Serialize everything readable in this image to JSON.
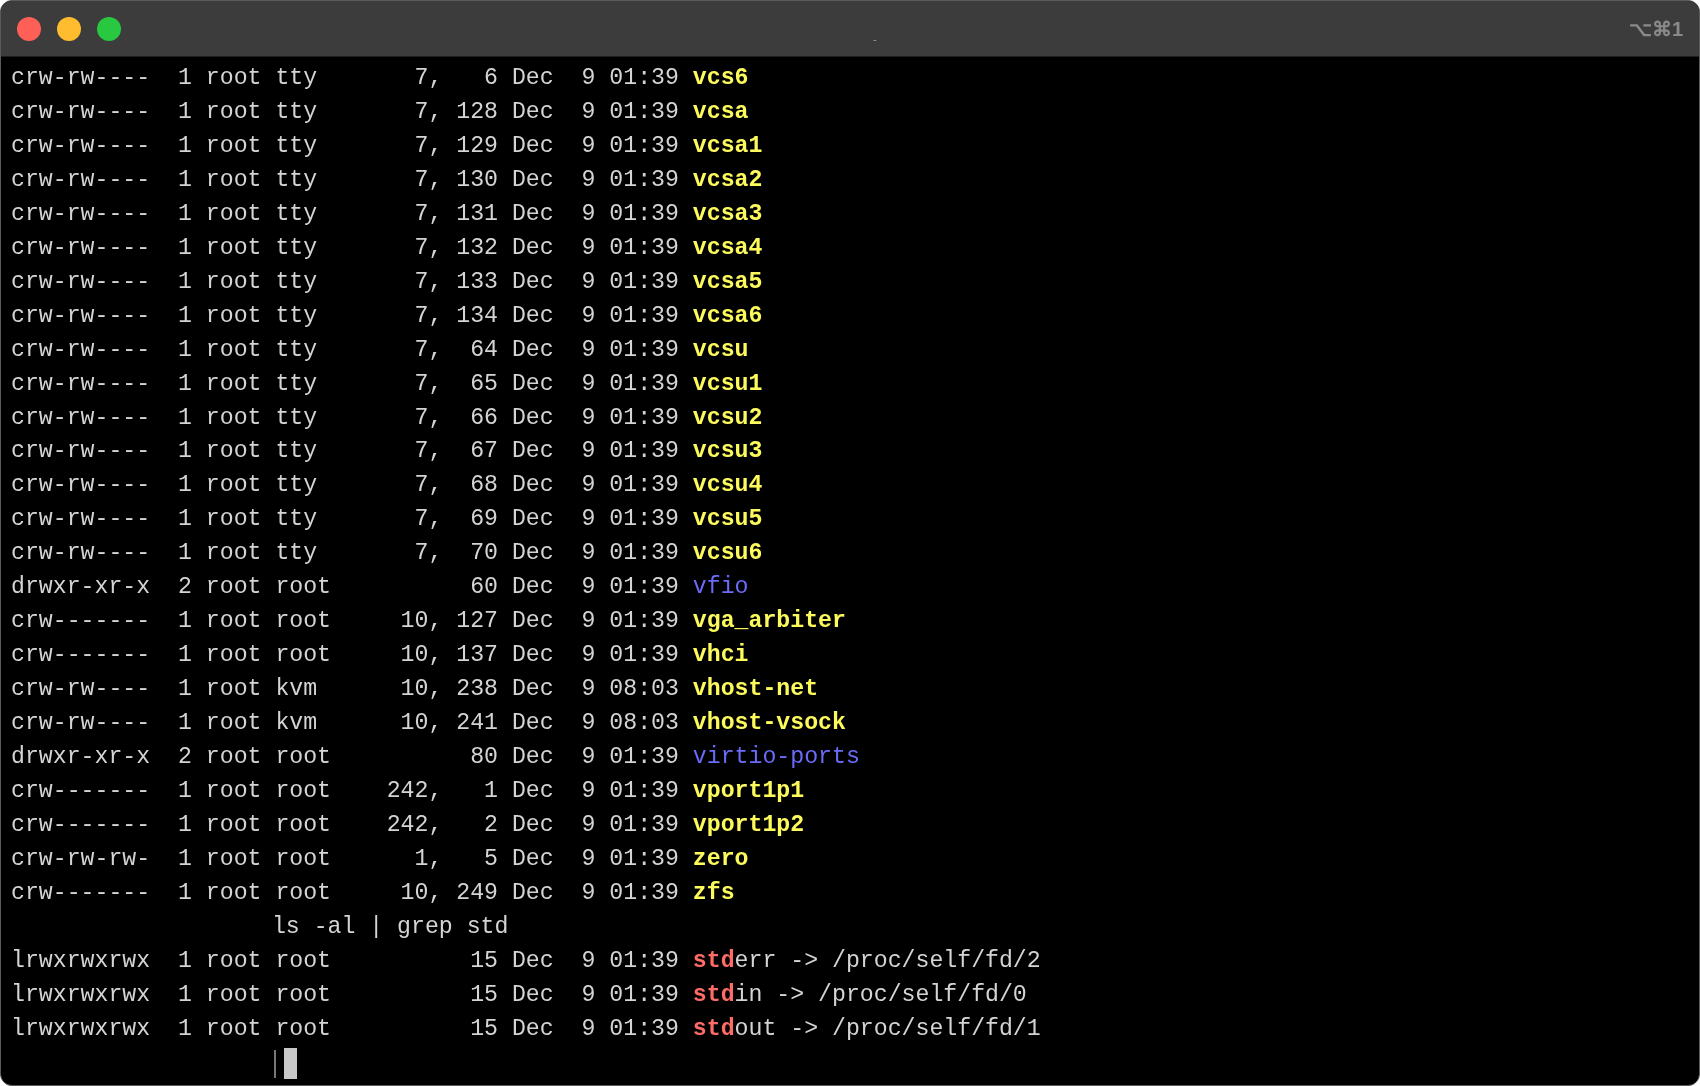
{
  "window": {
    "title": "-",
    "shortcut": "⌥⌘1"
  },
  "lines": [
    {
      "kind": "device",
      "info": "crw-rw----  1 root tty       7,   6 Dec  9 01:39 ",
      "name": "vcs6"
    },
    {
      "kind": "device",
      "info": "crw-rw----  1 root tty       7, 128 Dec  9 01:39 ",
      "name": "vcsa"
    },
    {
      "kind": "device",
      "info": "crw-rw----  1 root tty       7, 129 Dec  9 01:39 ",
      "name": "vcsa1"
    },
    {
      "kind": "device",
      "info": "crw-rw----  1 root tty       7, 130 Dec  9 01:39 ",
      "name": "vcsa2"
    },
    {
      "kind": "device",
      "info": "crw-rw----  1 root tty       7, 131 Dec  9 01:39 ",
      "name": "vcsa3"
    },
    {
      "kind": "device",
      "info": "crw-rw----  1 root tty       7, 132 Dec  9 01:39 ",
      "name": "vcsa4"
    },
    {
      "kind": "device",
      "info": "crw-rw----  1 root tty       7, 133 Dec  9 01:39 ",
      "name": "vcsa5"
    },
    {
      "kind": "device",
      "info": "crw-rw----  1 root tty       7, 134 Dec  9 01:39 ",
      "name": "vcsa6"
    },
    {
      "kind": "device",
      "info": "crw-rw----  1 root tty       7,  64 Dec  9 01:39 ",
      "name": "vcsu"
    },
    {
      "kind": "device",
      "info": "crw-rw----  1 root tty       7,  65 Dec  9 01:39 ",
      "name": "vcsu1"
    },
    {
      "kind": "device",
      "info": "crw-rw----  1 root tty       7,  66 Dec  9 01:39 ",
      "name": "vcsu2"
    },
    {
      "kind": "device",
      "info": "crw-rw----  1 root tty       7,  67 Dec  9 01:39 ",
      "name": "vcsu3"
    },
    {
      "kind": "device",
      "info": "crw-rw----  1 root tty       7,  68 Dec  9 01:39 ",
      "name": "vcsu4"
    },
    {
      "kind": "device",
      "info": "crw-rw----  1 root tty       7,  69 Dec  9 01:39 ",
      "name": "vcsu5"
    },
    {
      "kind": "device",
      "info": "crw-rw----  1 root tty       7,  70 Dec  9 01:39 ",
      "name": "vcsu6"
    },
    {
      "kind": "directory",
      "info": "drwxr-xr-x  2 root root          60 Dec  9 01:39 ",
      "name": "vfio"
    },
    {
      "kind": "device",
      "info": "crw-------  1 root root     10, 127 Dec  9 01:39 ",
      "name": "vga_arbiter"
    },
    {
      "kind": "device",
      "info": "crw-------  1 root root     10, 137 Dec  9 01:39 ",
      "name": "vhci"
    },
    {
      "kind": "device",
      "info": "crw-rw----  1 root kvm      10, 238 Dec  9 08:03 ",
      "name": "vhost-net"
    },
    {
      "kind": "device",
      "info": "crw-rw----  1 root kvm      10, 241 Dec  9 08:03 ",
      "name": "vhost-vsock"
    },
    {
      "kind": "directory",
      "info": "drwxr-xr-x  2 root root          80 Dec  9 01:39 ",
      "name": "virtio-ports"
    },
    {
      "kind": "device",
      "info": "crw-------  1 root root    242,   1 Dec  9 01:39 ",
      "name": "vport1p1"
    },
    {
      "kind": "device",
      "info": "crw-------  1 root root    242,   2 Dec  9 01:39 ",
      "name": "vport1p2"
    },
    {
      "kind": "device",
      "info": "crw-rw-rw-  1 root root      1,   5 Dec  9 01:39 ",
      "name": "zero"
    },
    {
      "kind": "device",
      "info": "crw-------  1 root root     10, 249 Dec  9 01:39 ",
      "name": "zfs"
    },
    {
      "kind": "command",
      "text": "ls -al | grep std"
    },
    {
      "kind": "link",
      "info": "lrwxrwxrwx  1 root root          15 Dec  9 01:39 ",
      "match": "std",
      "name": "err -> /proc/self/fd/2"
    },
    {
      "kind": "link",
      "info": "lrwxrwxrwx  1 root root          15 Dec  9 01:39 ",
      "match": "std",
      "name": "in -> /proc/self/fd/0"
    },
    {
      "kind": "link",
      "info": "lrwxrwxrwx  1 root root          15 Dec  9 01:39 ",
      "match": "std",
      "name": "out -> /proc/self/fd/1"
    }
  ]
}
